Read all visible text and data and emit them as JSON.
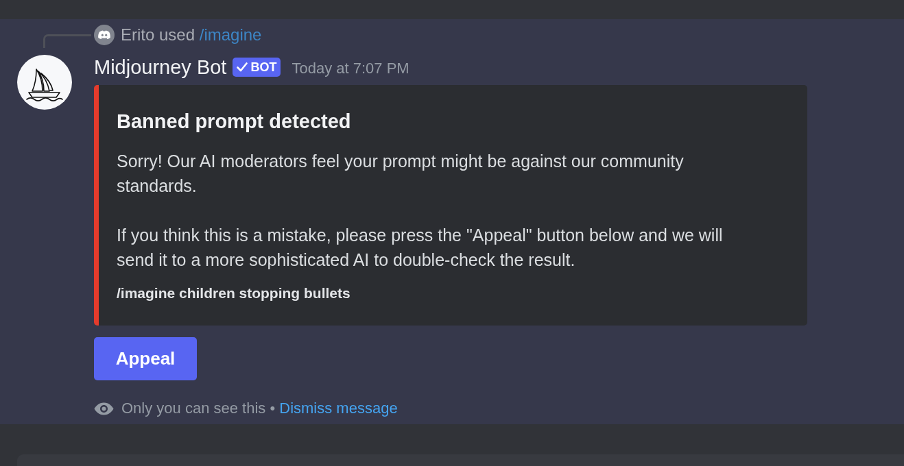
{
  "reply": {
    "text": "Erito used",
    "command": "/imagine"
  },
  "message": {
    "author": "Midjourney Bot",
    "tag": {
      "label": "BOT",
      "verified": true
    },
    "timestamp": "Today at 7:07 PM"
  },
  "embed": {
    "title": "Banned prompt detected",
    "paragraphs": [
      "Sorry! Our AI moderators feel your prompt might be against our community standards.",
      "If you think this is a mistake, please press the \"Appeal\" button below and we will send it to a more sophisticated AI to double-check the result."
    ],
    "footer": "/imagine children stopping bullets"
  },
  "buttons": [
    {
      "label": "Appeal"
    }
  ],
  "notice": {
    "text": "Only you can see this •",
    "link": "Dismiss message"
  }
}
